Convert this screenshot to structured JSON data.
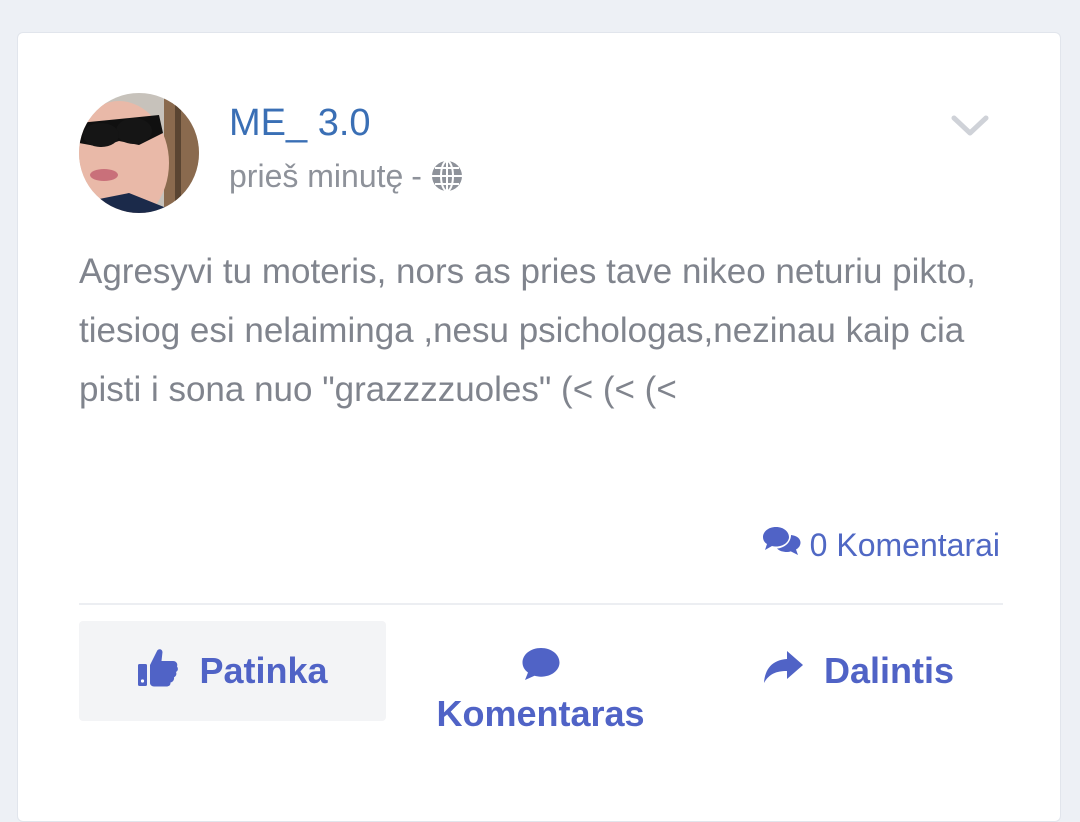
{
  "post": {
    "author": "ME_ 3.0",
    "time": "prieš minutę",
    "separator": "-",
    "visibility_icon": "globe-icon",
    "text": "Agresyvi tu moteris, nors as pries tave nikeo neturiu pikto, tiesiog esi nelaiminga ,nesu psichologas,nezinau kaip cia pisti i sona nuo \"grazzzzuoles\" (< (< (<",
    "comments_count": "0 Komentarai"
  },
  "actions": {
    "like": "Patinka",
    "comment": "Komentaras",
    "share": "Dalintis"
  },
  "icons": {
    "like": "thumbs-up-icon",
    "comment": "comment-icon",
    "comments": "comments-icon",
    "share": "share-icon",
    "menu": "chevron-down-icon"
  },
  "colors": {
    "accent": "#5063c6",
    "author": "#3a6fb5",
    "text": "#80848d",
    "meta": "#8e929a"
  }
}
